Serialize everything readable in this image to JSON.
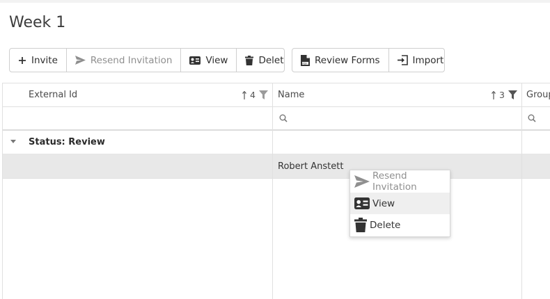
{
  "page": {
    "title": "Week 1"
  },
  "toolbar": {
    "invite_label": "Invite",
    "resend_label": "Resend Invitation",
    "view_label": "View",
    "delete_label": "Delete",
    "review_forms_label": "Review Forms",
    "import_label": "Import"
  },
  "grid": {
    "columns": [
      {
        "label": "External Id",
        "sort_order": "4"
      },
      {
        "label": "Name",
        "sort_order": "3"
      },
      {
        "label": "Group"
      }
    ],
    "group_row": {
      "label": "Status: Review"
    },
    "rows": [
      {
        "external_id": "",
        "name": "Robert Anstett"
      }
    ]
  },
  "context_menu": {
    "items": [
      {
        "label": "Resend Invitation",
        "disabled": true
      },
      {
        "label": "View",
        "hovered": true
      },
      {
        "label": "Delete"
      }
    ]
  },
  "colors": {
    "row_selected_bg": "#e8e8e8",
    "border": "#e0e0e0",
    "disabled_text": "#8f8f8f"
  }
}
